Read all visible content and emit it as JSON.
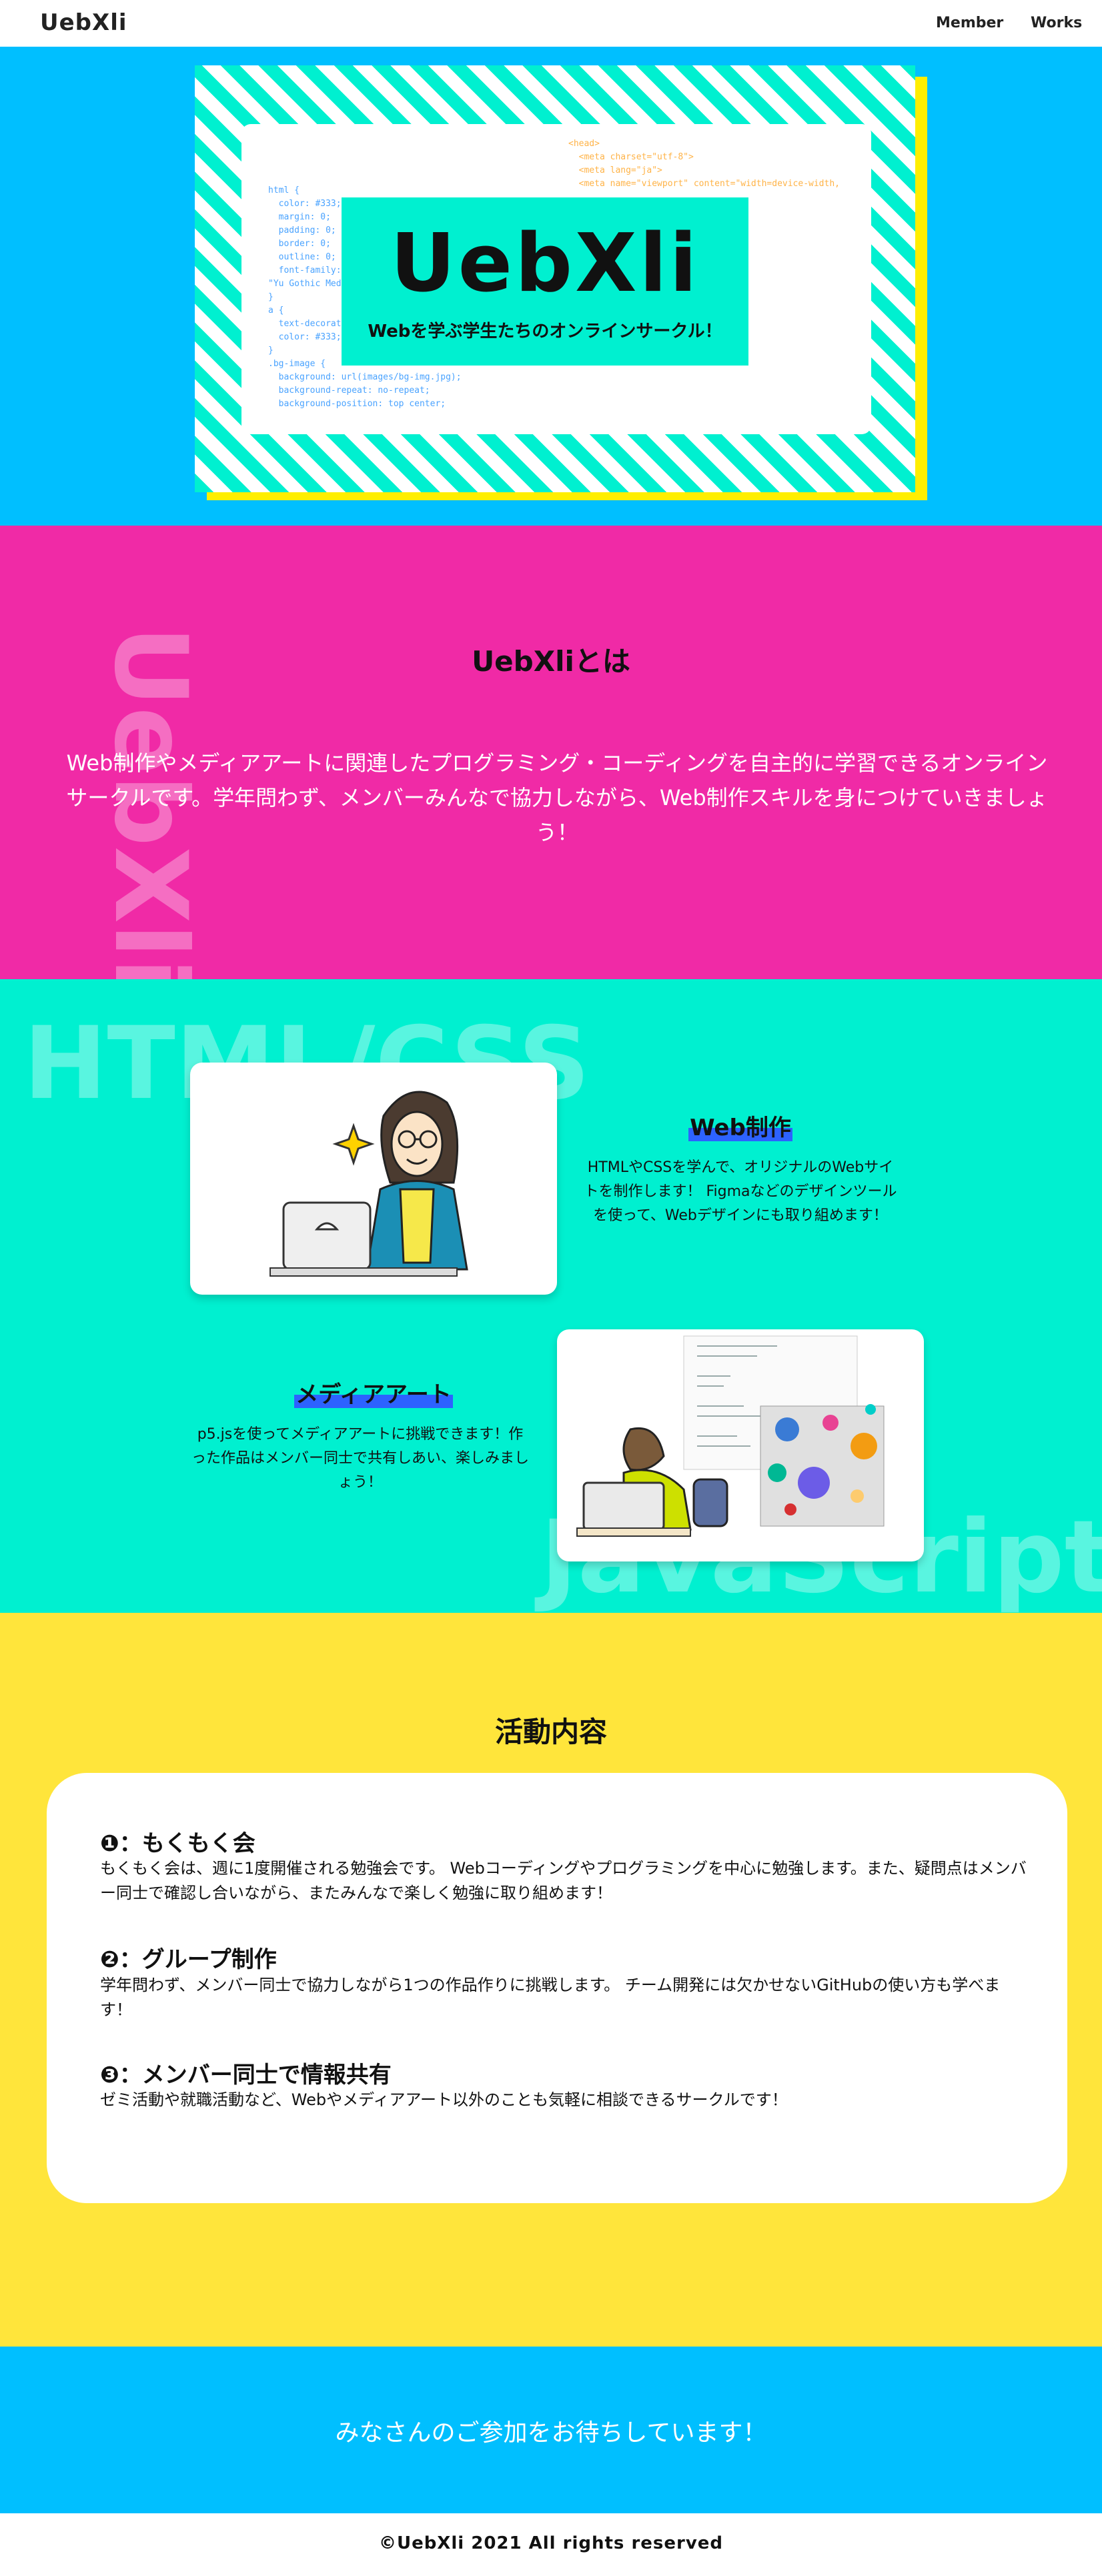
{
  "header": {
    "logo": "UebXli",
    "nav": [
      "Member",
      "Works"
    ]
  },
  "hero": {
    "title": "UebXli",
    "subtitle": "Webを学ぶ学生たちのオンラインサークル！",
    "code_left": "html {\n  color: #333;\n  margin: 0;\n  padding: 0;\n  border: 0;\n  outline: 0;\n  font-family: \"\n\"Yu Gothic Med\n}\na {\n  text-decoratio\n  color: #333;\n}\n.bg-image {\n  background: url(images/bg-img.jpg);\n  background-repeat: no-repeat;\n  background-position: top center;",
    "code_right": "<head>\n  <meta charset=\"utf-8\">\n  <meta lang=\"ja\">\n  <meta name=\"viewport\" content=\"width=device-width,\n\n                  \"ウェブクリサイトで\n\n\n          dist/ress.min.css\"\n\n\n          .com/css2?\n          lesheet\">\n          s\">"
  },
  "about": {
    "bg_text": "UebXli",
    "title": "UebXliとは",
    "text": "Web制作やメディアアートに関連したプログラミング・コーディングを自主的に学習できるオンラインサークルです。学年問わず、メンバーみんなで協力しながら、Web制作スキルを身につけていきましょう！"
  },
  "works": {
    "bg_text_1": "HTML/CSS",
    "bg_text_2": "JavaScript",
    "items": [
      {
        "title": "Web制作",
        "text": "HTMLやCSSを学んで、オリジナルのWebサイトを制作します！ Figmaなどのデザインツールを使って、Webデザインにも取り組めます！"
      },
      {
        "title": "メディアアート",
        "text": "p5.jsを使ってメディアアートに挑戦できます！作った作品はメンバー同士で共有しあい、楽しみましょう！"
      }
    ]
  },
  "activities": {
    "title": "活動内容",
    "items": [
      {
        "title": "❶：もくもく会",
        "text": "もくもく会は、週に1度開催される勉強会です。 Webコーディングやプログラミングを中心に勉強します。また、疑問点はメンバー同士で確認し合いながら、またみんなで楽しく勉強に取り組めます！"
      },
      {
        "title": "❷：グループ制作",
        "text": "学年問わず、メンバー同士で協力しながら1つの作品作りに挑戦します。 チーム開発には欠かせないGitHubの使い方も学べます！"
      },
      {
        "title": "❸：メンバー同士で情報共有",
        "text": "ゼミ活動や就職活動など、Webやメディアアート以外のことも気軽に相談できるサークルです！"
      }
    ]
  },
  "cta": {
    "text": "みなさんのご参加をお待ちしています！"
  },
  "footer": {
    "copyright": "©UebXli 2021 All rights reserved"
  },
  "colors": {
    "blue": "#00bfff",
    "pink": "#f02aa6",
    "teal": "#00f0d0",
    "yellow": "#ffe53b",
    "highlight": "#2d62ff"
  }
}
